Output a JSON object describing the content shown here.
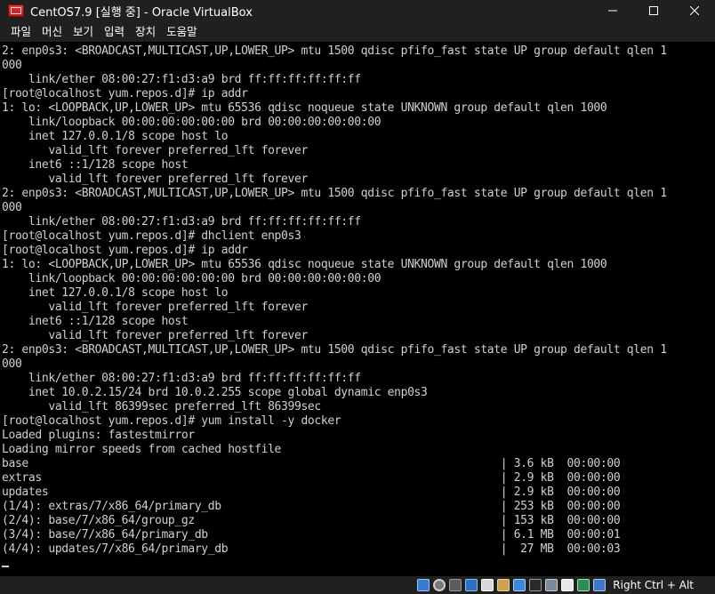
{
  "window": {
    "title": "CentOS7.9 [실행 중] - Oracle VirtualBox",
    "controls": {
      "minimize": "—",
      "maximize": "☐",
      "close": "✕"
    }
  },
  "menu": [
    "파일",
    "머신",
    "보기",
    "입력",
    "장치",
    "도움말"
  ],
  "console": {
    "lines": [
      "2: enp0s3: <BROADCAST,MULTICAST,UP,LOWER_UP> mtu 1500 qdisc pfifo_fast state UP group default qlen 1",
      "000",
      "    link/ether 08:00:27:f1:d3:a9 brd ff:ff:ff:ff:ff:ff",
      "[root@localhost yum.repos.d]# ip addr",
      "1: lo: <LOOPBACK,UP,LOWER_UP> mtu 65536 qdisc noqueue state UNKNOWN group default qlen 1000",
      "    link/loopback 00:00:00:00:00:00 brd 00:00:00:00:00:00",
      "    inet 127.0.0.1/8 scope host lo",
      "       valid_lft forever preferred_lft forever",
      "    inet6 ::1/128 scope host",
      "       valid_lft forever preferred_lft forever",
      "2: enp0s3: <BROADCAST,MULTICAST,UP,LOWER_UP> mtu 1500 qdisc pfifo_fast state UP group default qlen 1",
      "000",
      "    link/ether 08:00:27:f1:d3:a9 brd ff:ff:ff:ff:ff:ff",
      "[root@localhost yum.repos.d]# dhclient enp0s3",
      "[root@localhost yum.repos.d]# ip addr",
      "1: lo: <LOOPBACK,UP,LOWER_UP> mtu 65536 qdisc noqueue state UNKNOWN group default qlen 1000",
      "    link/loopback 00:00:00:00:00:00 brd 00:00:00:00:00:00",
      "    inet 127.0.0.1/8 scope host lo",
      "       valid_lft forever preferred_lft forever",
      "    inet6 ::1/128 scope host",
      "       valid_lft forever preferred_lft forever",
      "2: enp0s3: <BROADCAST,MULTICAST,UP,LOWER_UP> mtu 1500 qdisc pfifo_fast state UP group default qlen 1",
      "000",
      "    link/ether 08:00:27:f1:d3:a9 brd ff:ff:ff:ff:ff:ff",
      "    inet 10.0.2.15/24 brd 10.0.2.255 scope global dynamic enp0s3",
      "       valid_lft 86399sec preferred_lft 86399sec",
      "[root@localhost yum.repos.d]# yum install -y docker",
      "Loaded plugins: fastestmirror",
      "Loading mirror speeds from cached hostfile",
      "base                                                                       | 3.6 kB  00:00:00",
      "extras                                                                     | 2.9 kB  00:00:00",
      "updates                                                                    | 2.9 kB  00:00:00",
      "(1/4): extras/7/x86_64/primary_db                                          | 253 kB  00:00:00",
      "(2/4): base/7/x86_64/group_gz                                              | 153 kB  00:00:00",
      "(3/4): base/7/x86_64/primary_db                                            | 6.1 MB  00:00:01",
      "(4/4): updates/7/x86_64/primary_db                                         |  27 MB  00:00:03"
    ]
  },
  "status": {
    "icons": [
      "hard-disk-icon",
      "optical-drive-icon",
      "audio-icon",
      "network-icon",
      "usb-icon",
      "shared-folder-icon",
      "display-icon",
      "recording-icon",
      "cpu-icon",
      "vt-x-icon",
      "mouse-integration-icon",
      "keyboard-icon"
    ],
    "host_key": "Right Ctrl + Alt"
  },
  "colors": {
    "console_bg": "#000000",
    "console_text": "#d0d0d0",
    "chrome_bg": "#202020"
  }
}
